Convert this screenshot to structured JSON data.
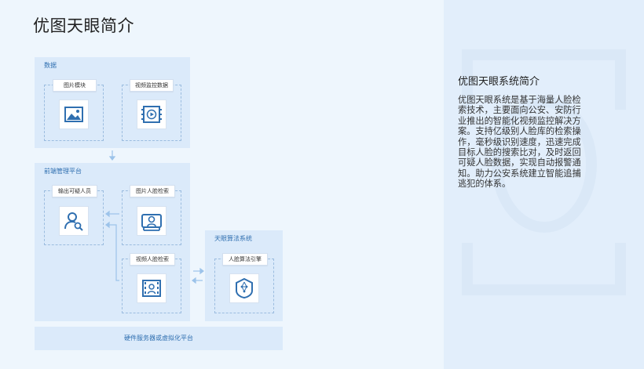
{
  "page_title": "优图天眼简介",
  "info": {
    "title": "优图天眼系统简介",
    "body": "优图天眼系统是基于海量人脸检索技术，主要面向公安、安防行业推出的智能化视频监控解决方案。支持亿级别人脸库的检索操作，毫秒级识别速度，迅速完成目标人脸的搜索比对，及时返回可疑人脸数据，实现自动报警通知。助力公安系统建立智能追捕逃犯的体系。"
  },
  "diagram": {
    "data_section": {
      "label": "数据",
      "nodes": [
        {
          "label": "图片模块",
          "icon": "image-icon"
        },
        {
          "label": "视频监控数据",
          "icon": "video-icon"
        }
      ]
    },
    "frontend_section": {
      "label": "前端管理平台",
      "nodes": [
        {
          "label": "输出可疑人员",
          "icon": "person-search-icon"
        },
        {
          "label": "图片人脸检索",
          "icon": "face-photo-icon"
        },
        {
          "label": "视频人脸检索",
          "icon": "face-video-icon"
        }
      ]
    },
    "algo_section": {
      "label": "天眼算法系统",
      "nodes": [
        {
          "label": "人脸算法引擎",
          "icon": "face-engine-icon"
        }
      ]
    },
    "footer": "硬件服务器或虚拟化平台"
  },
  "colors": {
    "background": "#eef6fd",
    "section": "#dbeafa",
    "accent": "#2f6fb0",
    "icon": "#2f6fb0"
  }
}
